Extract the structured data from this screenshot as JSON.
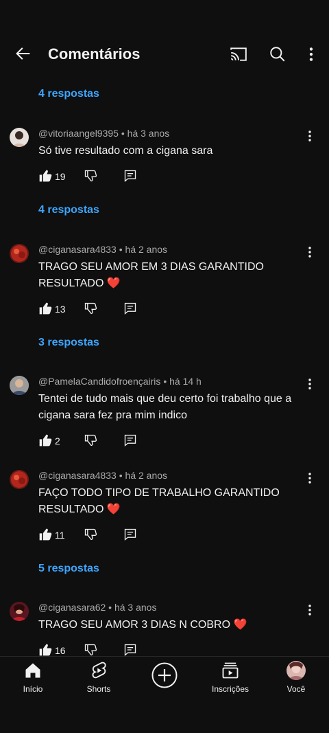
{
  "header": {
    "title": "Comentários",
    "icons": [
      "back-arrow-icon",
      "cast-icon",
      "search-icon",
      "more-vert-icon"
    ]
  },
  "reply_links": [
    "4 respostas",
    "4 respostas",
    "3 respostas",
    "5 respostas"
  ],
  "comments": [
    {
      "author": "@vitoriaangel9395",
      "age": "há 3 anos",
      "text": "Só tive resultado com a cigana sara",
      "likes": "19"
    },
    {
      "author": "@ciganasara4833",
      "age": "há 2 anos",
      "text": "TRAGO SEU AMOR EM 3 DIAS GARANTIDO RESULTADO ❤️",
      "likes": "13"
    },
    {
      "author": "@PamelaCandidofroençairis",
      "age": "há 14 h",
      "text": "Tentei de tudo mais que deu certo foi trabalho que a cigana sara fez pra mim indico",
      "likes": "2"
    },
    {
      "author": "@ciganasara4833",
      "age": "há 2 anos",
      "text": "FAÇO TODO TIPO DE TRABALHO GARANTIDO RESULTADO ❤️",
      "likes": "11"
    },
    {
      "author": "@ciganasara62",
      "age": "há 3 anos",
      "text": "TRAGO SEU AMOR 3 DIAS N COBRO ❤️",
      "likes": "16"
    }
  ],
  "meta_separator": "•",
  "bottom_nav": {
    "home": "Início",
    "shorts": "Shorts",
    "subscriptions": "Inscrições",
    "you": "Você"
  },
  "colors": {
    "background": "#0f0f0f",
    "link": "#3ea6ff",
    "text": "#f1f1f1",
    "muted": "#aaaaaa"
  }
}
